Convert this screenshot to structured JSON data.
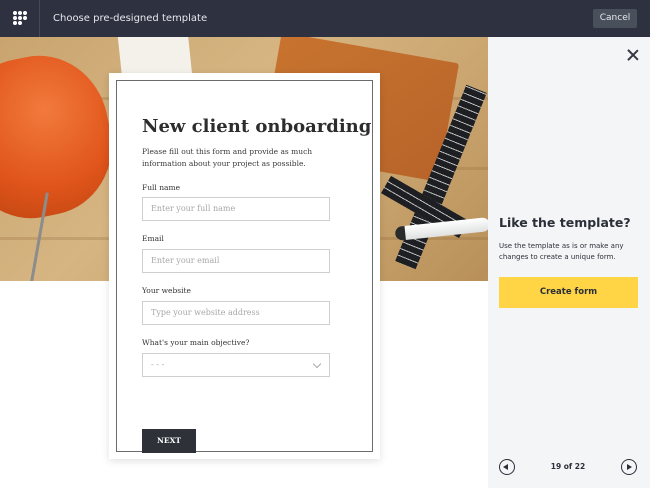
{
  "header": {
    "title": "Choose pre-designed template",
    "cancel_label": "Cancel",
    "logo_icon": "logo-dots-icon",
    "background": "#2e3240"
  },
  "form": {
    "title": "New client onboarding",
    "description": "Please fill out this form and provide as much information about your project as possible.",
    "fields": [
      {
        "label": "Full name",
        "placeholder": "Enter your full name"
      },
      {
        "label": "Email",
        "placeholder": "Enter your email"
      },
      {
        "label": "Your website",
        "placeholder": "Type your website address"
      },
      {
        "label": "What's your main objective?",
        "placeholder": "- - -"
      }
    ],
    "next_label": "NEXT"
  },
  "side": {
    "close_icon": "close-icon",
    "title": "Like the template?",
    "description": "Use the template as is or make any changes to create a unique form.",
    "create_label": "Create form",
    "accent": "#ffd545",
    "pagination": "19 of 22"
  }
}
